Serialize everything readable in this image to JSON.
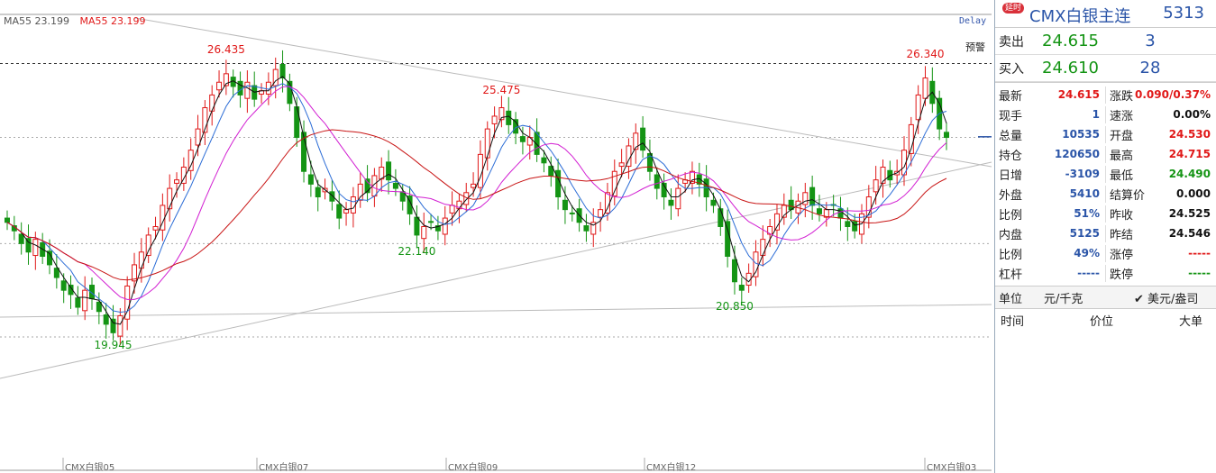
{
  "legend": {
    "ma55_label_1": "MA55 23.199",
    "ma55_label_2": "MA55 23.199",
    "color_1": "#555555",
    "color_2": "#e01818"
  },
  "delay_label": "Delay",
  "alert_label": "预警",
  "chart_data": {
    "type": "candlestick",
    "title": "",
    "ylim": [
      18.5,
      27.2
    ],
    "price_markers": [
      {
        "label": "26.435",
        "value": 26.435,
        "kind": "high"
      },
      {
        "label": "25.475",
        "value": 25.475,
        "kind": "high"
      },
      {
        "label": "26.340",
        "value": 26.34,
        "kind": "high"
      },
      {
        "label": "19.945",
        "value": 19.945,
        "kind": "low"
      },
      {
        "label": "22.140",
        "value": 22.14,
        "kind": "low"
      },
      {
        "label": "20.850",
        "value": 20.85,
        "kind": "low"
      }
    ],
    "x_ticks": [
      "CMX白银05",
      "CMX白银07",
      "CMX白银09",
      "CMX白银12",
      "CMX白银03"
    ],
    "last_price": 24.615,
    "candles_close": [
      22.6,
      22.4,
      22.1,
      21.9,
      22.2,
      21.8,
      21.6,
      21.3,
      21.0,
      20.9,
      20.6,
      21.0,
      20.8,
      20.5,
      20.2,
      20.0,
      20.4,
      21.1,
      21.6,
      21.9,
      22.3,
      22.5,
      23.0,
      23.4,
      23.6,
      23.9,
      24.3,
      24.8,
      25.3,
      25.6,
      25.9,
      26.1,
      25.8,
      25.6,
      25.9,
      25.5,
      25.7,
      25.9,
      26.2,
      26.0,
      25.4,
      24.6,
      23.8,
      23.5,
      23.2,
      23.4,
      23.1,
      22.7,
      22.9,
      23.2,
      23.5,
      23.3,
      23.7,
      23.9,
      23.6,
      23.4,
      23.1,
      22.8,
      22.3,
      22.5,
      22.6,
      22.4,
      22.7,
      23.0,
      23.1,
      23.3,
      23.5,
      24.2,
      24.8,
      25.1,
      25.3,
      24.9,
      24.7,
      24.5,
      24.6,
      24.2,
      24.0,
      23.7,
      23.2,
      22.9,
      22.8,
      22.6,
      22.4,
      22.6,
      22.9,
      23.3,
      23.8,
      24.0,
      24.4,
      24.7,
      24.3,
      23.8,
      23.4,
      23.2,
      23.0,
      23.4,
      23.6,
      23.8,
      23.5,
      23.2,
      23.0,
      22.5,
      21.8,
      21.2,
      21.0,
      21.4,
      21.9,
      22.2,
      22.5,
      22.8,
      23.0,
      22.9,
      23.1,
      23.3,
      23.0,
      22.8,
      22.9,
      23.0,
      22.7,
      22.5,
      22.4,
      22.8,
      23.2,
      23.6,
      23.9,
      23.6,
      23.8,
      24.3,
      24.9,
      25.6,
      26.0,
      25.4,
      24.8,
      24.6
    ]
  },
  "panel": {
    "badge": "延时",
    "title": "CMX白银主连",
    "code": "5313",
    "sell_label": "卖出",
    "sell_price": "24.615",
    "sell_vol": "3",
    "buy_label": "买入",
    "buy_price": "24.610",
    "buy_vol": "28",
    "stats": [
      {
        "l1": "最新",
        "v1": "24.615",
        "c1": "red",
        "l2": "涨跌",
        "v2": "0.090/0.37%",
        "c2": "red"
      },
      {
        "l1": "现手",
        "v1": "1",
        "c1": "blue",
        "l2": "速涨",
        "v2": "0.00%",
        "c2": "black"
      },
      {
        "l1": "总量",
        "v1": "10535",
        "c1": "blue",
        "l2": "开盘",
        "v2": "24.530",
        "c2": "red"
      },
      {
        "l1": "持仓",
        "v1": "120650",
        "c1": "blue",
        "l2": "最高",
        "v2": "24.715",
        "c2": "red"
      },
      {
        "l1": "日增",
        "v1": "-3109",
        "c1": "blue",
        "l2": "最低",
        "v2": "24.490",
        "c2": "green"
      },
      {
        "l1": "外盘",
        "v1": "5410",
        "c1": "blue",
        "l2": "结算价",
        "v2": "0.000",
        "c2": "black"
      },
      {
        "l1": "比例",
        "v1": "51%",
        "c1": "blue",
        "l2": "昨收",
        "v2": "24.525",
        "c2": "black"
      },
      {
        "l1": "内盘",
        "v1": "5125",
        "c1": "blue",
        "l2": "昨结",
        "v2": "24.546",
        "c2": "black"
      },
      {
        "l1": "比例",
        "v1": "49%",
        "c1": "blue",
        "l2": "涨停",
        "v2": "-----",
        "c2": "red"
      },
      {
        "l1": "杠杆",
        "v1": "-----",
        "c1": "blue",
        "l2": "跌停",
        "v2": "-----",
        "c2": "green"
      }
    ],
    "unit_label": "单位",
    "unit_value": "元/千克",
    "unit_alt": "✔ 美元/盎司",
    "trade_time": "时间",
    "trade_price": "价位",
    "trade_big": "大单"
  }
}
